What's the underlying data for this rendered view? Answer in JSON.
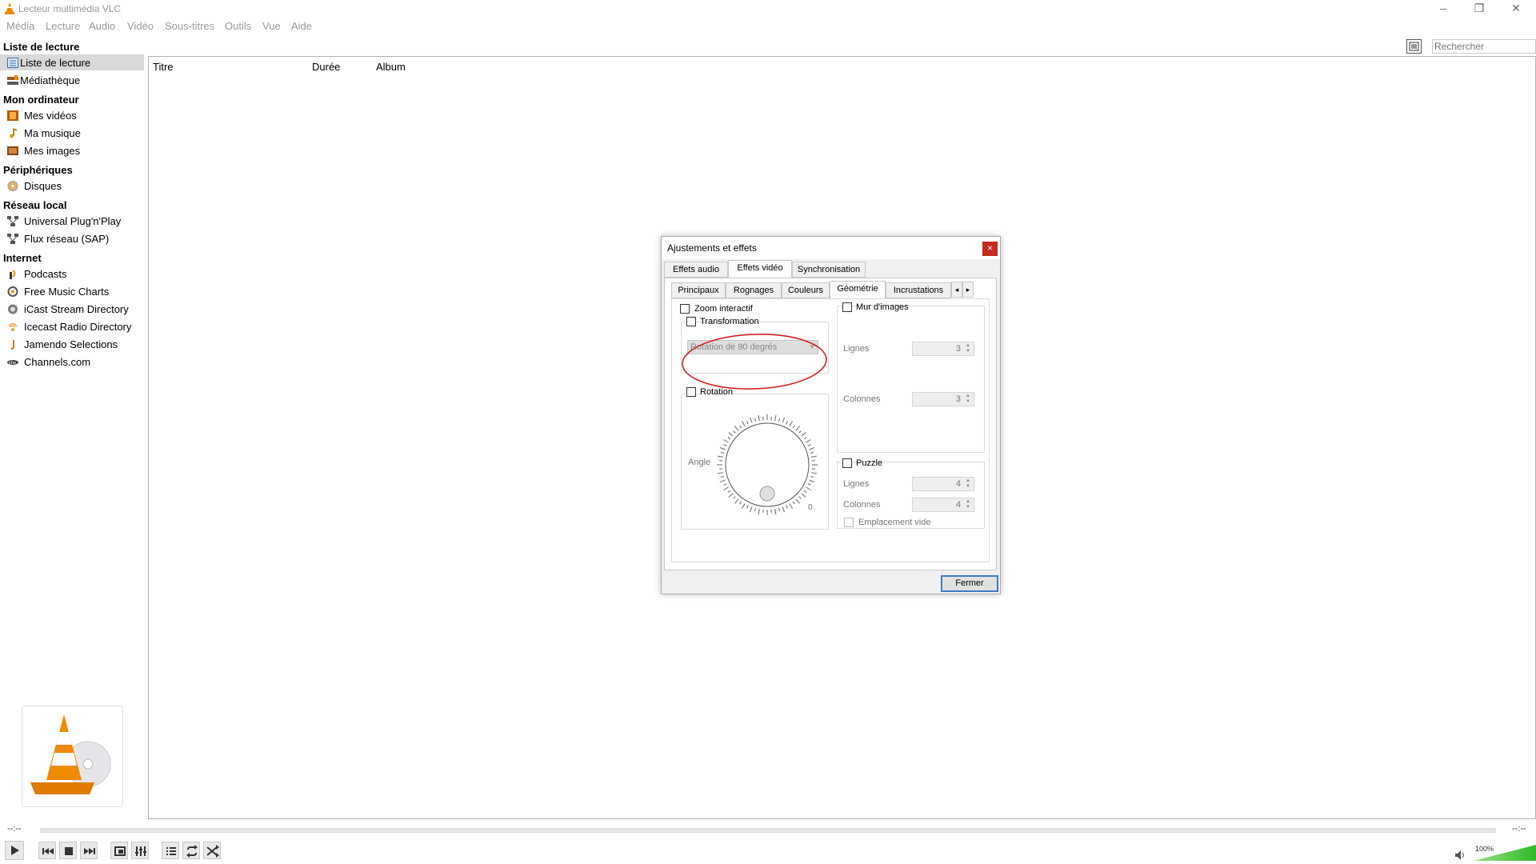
{
  "window": {
    "title": "Lecteur multimédia VLC"
  },
  "menu": [
    "Média",
    "Lecture",
    "Audio",
    "Vidéo",
    "Sous-titres",
    "Outils",
    "Vue",
    "Aide"
  ],
  "search": {
    "placeholder": "Rechercher"
  },
  "sidebar": {
    "sections": [
      {
        "header": "Liste de lecture",
        "items": [
          {
            "label": "Liste de lecture",
            "icon": "playlist-icon",
            "selected": true
          },
          {
            "label": "Médiathèque",
            "icon": "library-icon"
          }
        ]
      },
      {
        "header": "Mon ordinateur",
        "items": [
          {
            "label": "Mes vidéos",
            "icon": "film-icon"
          },
          {
            "label": "Ma musique",
            "icon": "music-note-icon"
          },
          {
            "label": "Mes images",
            "icon": "image-icon"
          }
        ]
      },
      {
        "header": "Périphériques",
        "items": [
          {
            "label": "Disques",
            "icon": "disc-icon"
          }
        ]
      },
      {
        "header": "Réseau local",
        "items": [
          {
            "label": "Universal Plug'n'Play",
            "icon": "network-icon"
          },
          {
            "label": "Flux réseau (SAP)",
            "icon": "network-icon"
          }
        ]
      },
      {
        "header": "Internet",
        "items": [
          {
            "label": "Podcasts",
            "icon": "podcast-icon"
          },
          {
            "label": "Free Music Charts",
            "icon": "charts-icon"
          },
          {
            "label": "iCast Stream Directory",
            "icon": "icast-icon"
          },
          {
            "label": "Icecast Radio Directory",
            "icon": "radio-icon"
          },
          {
            "label": "Jamendo Selections",
            "icon": "jamendo-icon"
          },
          {
            "label": "Channels.com",
            "icon": "channels-icon"
          }
        ]
      }
    ]
  },
  "playlist": {
    "columns": [
      "Titre",
      "Durée",
      "Album"
    ]
  },
  "player": {
    "time_elapsed": "--:--",
    "time_total": "--:--",
    "volume": "100%"
  },
  "dialog": {
    "title": "Ajustements et effets",
    "close_glyph": "×",
    "tabs": [
      "Effets audio",
      "Effets vidéo",
      "Synchronisation"
    ],
    "active_tab": "Effets vidéo",
    "subtabs": [
      "Principaux",
      "Rognages",
      "Couleurs",
      "Géométrie",
      "Incrustations"
    ],
    "active_subtab": "Géométrie",
    "zoom_label": "Zoom interactif",
    "transformation_label": "Transformation",
    "transformation_value": "Rotation de 90 degrés",
    "rotation_label": "Rotation",
    "angle_label": "Angle",
    "angle_zero": "0",
    "wall_label": "Mur d'images",
    "wall_rows_label": "Lignes",
    "wall_rows_value": "3",
    "wall_cols_label": "Colonnes",
    "wall_cols_value": "3",
    "puzzle_label": "Puzzle",
    "puzzle_rows_label": "Lignes",
    "puzzle_rows_value": "4",
    "puzzle_cols_label": "Colonnes",
    "puzzle_cols_value": "4",
    "empty_slot_label": "Emplacement vide",
    "close_button": "Fermer"
  },
  "colors": {
    "highlight_annotation": "#d42020",
    "vlc_orange": "#f08a00",
    "focus_blue": "#3d7bc8"
  }
}
